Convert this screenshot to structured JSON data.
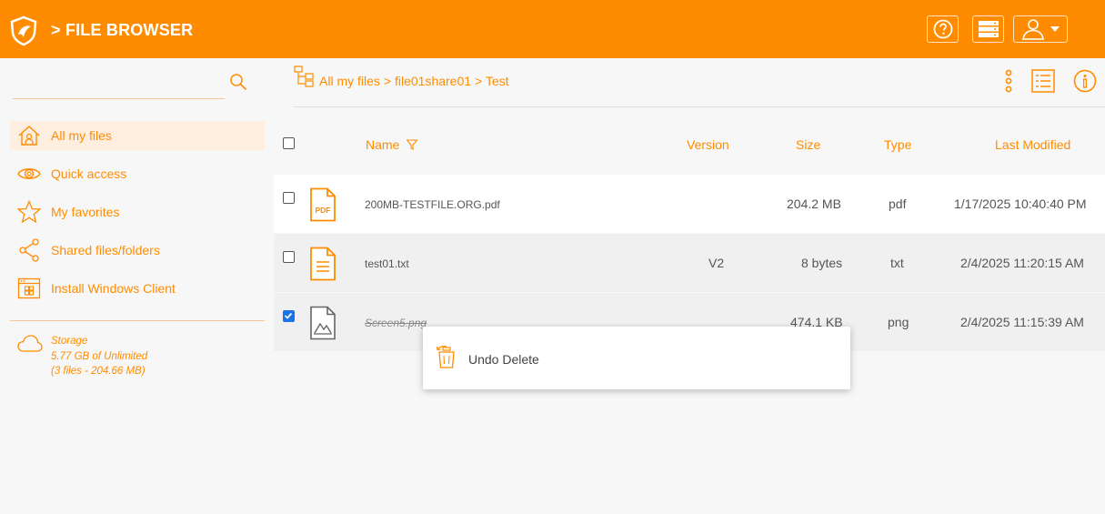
{
  "header": {
    "title": "> FILE BROWSER",
    "icons": [
      "shield-logo",
      "help-icon",
      "server-icon",
      "user-icon",
      "caret-down-icon"
    ]
  },
  "sidebar": {
    "search": {
      "placeholder": ""
    },
    "items": [
      {
        "label": "All my files",
        "icon": "home-icon",
        "active": true
      },
      {
        "label": "Quick access",
        "icon": "eye-icon",
        "active": false
      },
      {
        "label": "My favorites",
        "icon": "star-icon",
        "active": false
      },
      {
        "label": "Shared files/folders",
        "icon": "share-icon",
        "active": false
      },
      {
        "label": "Install Windows Client",
        "icon": "windows-client-icon",
        "active": false
      }
    ],
    "storage": {
      "title": "Storage",
      "usage": "5.77 GB of Unlimited",
      "summary": "(3 files - 204.66 MB)"
    }
  },
  "breadcrumb": {
    "root": "All my files",
    "share": "> file01share01",
    "folder": "> Test"
  },
  "table": {
    "columns": {
      "name": "Name",
      "version": "Version",
      "size": "Size",
      "type": "Type",
      "modified": "Last Modified"
    },
    "rows": [
      {
        "name": "200MB-TESTFILE.ORG.pdf",
        "version": "",
        "size": "204.2 MB",
        "type": "pdf",
        "modified": "1/17/2025 10:40:40 PM",
        "checked": false,
        "icon": "pdf-file-icon"
      },
      {
        "name": "test01.txt",
        "version": "V2",
        "size": "8 bytes",
        "type": "txt",
        "modified": "2/4/2025 11:20:15 AM",
        "checked": false,
        "icon": "text-file-icon"
      },
      {
        "name": "Screen5.png",
        "version": "",
        "size": "474.1 KB",
        "type": "png",
        "modified": "2/4/2025 11:15:39 AM",
        "checked": true,
        "deleted": true,
        "icon": "image-file-icon"
      }
    ]
  },
  "context_menu": {
    "undo_delete": "Undo Delete"
  },
  "colors": {
    "accent": "#ff8c00",
    "checkbox": "#1a73e8"
  }
}
